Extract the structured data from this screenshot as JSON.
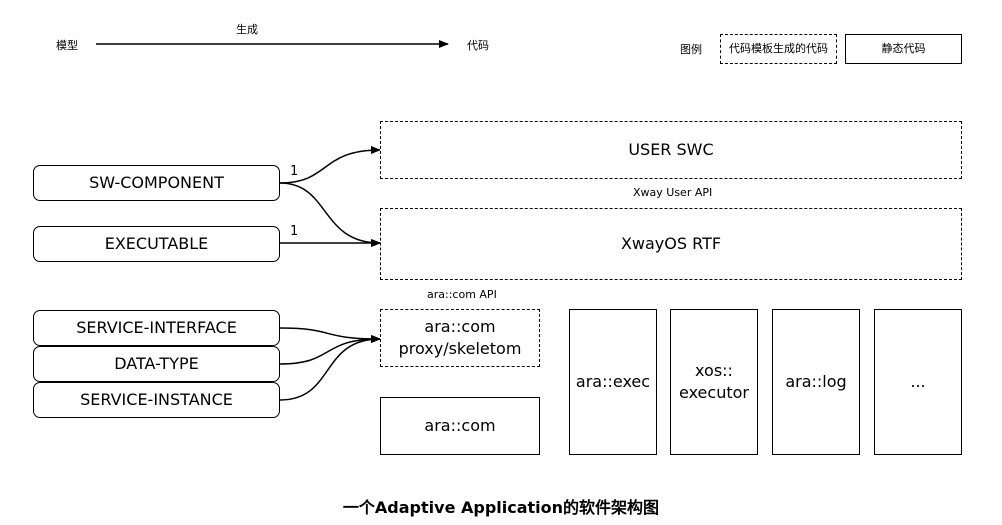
{
  "legend_top": {
    "source": "模型",
    "arrow_label": "生成",
    "target": "代码",
    "legend_title": "图例",
    "generated_code": "代码模板生成的代码",
    "static_code": "静态代码"
  },
  "models": {
    "sw_component": "SW-COMPONENT",
    "executable": "EXECUTABLE",
    "service_interface": "SERVICE-INTERFACE",
    "data_type": "DATA-TYPE",
    "service_instance": "SERVICE-INSTANCE"
  },
  "multiplicity": {
    "sw_component": "1",
    "executable": "1"
  },
  "code": {
    "user_swc": "USER SWC",
    "user_api": "Xway User API",
    "rtf": "XwayOS RTF",
    "com_api": "ara::com API",
    "com_proxy": "ara::com\nproxy/skeletom",
    "com": "ara::com",
    "exec": "ara::exec",
    "executor": "xos::\nexecutor",
    "log": "ara::log",
    "more": "..."
  },
  "caption": "一个Adaptive Application的软件架构图"
}
